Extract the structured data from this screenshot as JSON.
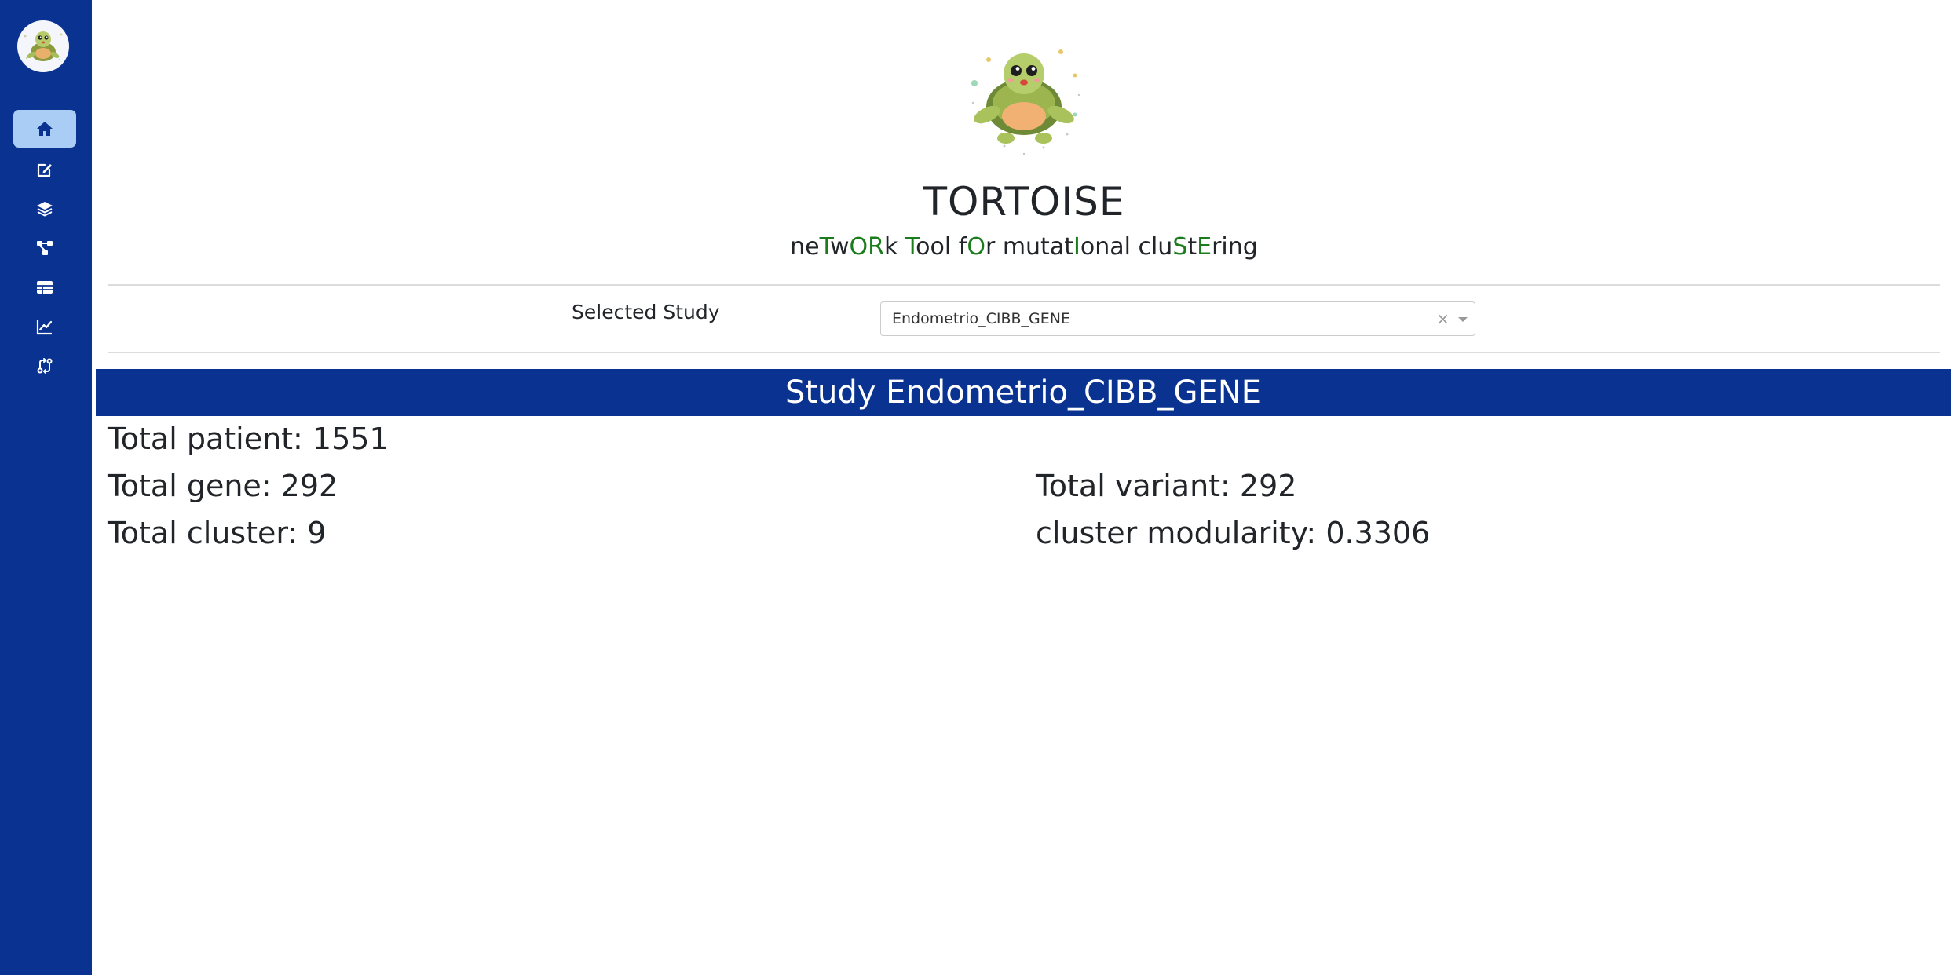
{
  "sidebar": {
    "logo_icon": "tortoise-logo-icon",
    "items": [
      {
        "name": "home",
        "icon": "home-icon",
        "active": true
      },
      {
        "name": "edit",
        "icon": "edit-icon",
        "active": false
      },
      {
        "name": "layers",
        "icon": "layers-icon",
        "active": false
      },
      {
        "name": "network",
        "icon": "network-icon",
        "active": false
      },
      {
        "name": "table",
        "icon": "table-icon",
        "active": false
      },
      {
        "name": "chart",
        "icon": "line-chart-icon",
        "active": false
      },
      {
        "name": "compare",
        "icon": "compare-arrows-icon",
        "active": false
      }
    ]
  },
  "header": {
    "title": "TORTOISE",
    "subtitle_parts": [
      {
        "text": "ne",
        "hl": false
      },
      {
        "text": "T",
        "hl": true
      },
      {
        "text": "w",
        "hl": false
      },
      {
        "text": "OR",
        "hl": true
      },
      {
        "text": "k ",
        "hl": false
      },
      {
        "text": "T",
        "hl": true
      },
      {
        "text": "ool f",
        "hl": false
      },
      {
        "text": "O",
        "hl": true
      },
      {
        "text": "r mutat",
        "hl": false
      },
      {
        "text": "I",
        "hl": true
      },
      {
        "text": "onal clu",
        "hl": false
      },
      {
        "text": "S",
        "hl": true
      },
      {
        "text": "t",
        "hl": false
      },
      {
        "text": "E",
        "hl": true
      },
      {
        "text": "ring",
        "hl": false
      }
    ]
  },
  "study_selector": {
    "label": "Selected Study",
    "value": "Endometrio_CIBB_GENE",
    "clear_symbol": "×"
  },
  "study": {
    "banner": "Study Endometrio_CIBB_GENE",
    "total_patient": "Total patient: 1551",
    "total_gene": "Total gene: 292",
    "total_variant": "Total variant: 292",
    "total_cluster": "Total cluster: 9",
    "cluster_modularity": "cluster modularity: 0.3306"
  },
  "colors": {
    "sidebar_bg": "#0a3290",
    "active_nav_bg": "#a9cdf4",
    "highlight_green": "#1a7c1a",
    "banner_bg": "#0a3290"
  }
}
